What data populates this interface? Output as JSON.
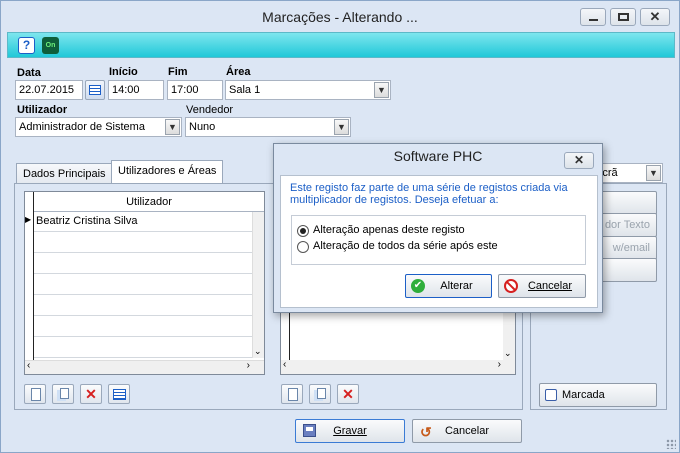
{
  "window": {
    "title": "Marcações - Alterando ..."
  },
  "toolbar": {
    "icons": [
      "help-icon",
      "on-icon"
    ]
  },
  "form": {
    "data_label": "Data",
    "data_value": "22.07.2015",
    "inicio_label": "Início",
    "inicio_value": "14:00",
    "fim_label": "Fim",
    "fim_value": "17:00",
    "area_label": "Área",
    "area_value": "Sala 1",
    "utilizador_label": "Utilizador",
    "utilizador_value": "Administrador de Sistema",
    "vendedor_label": "Vendedor",
    "vendedor_value": "Nuno"
  },
  "tabs": [
    {
      "label": "Dados Principais"
    },
    {
      "label": "Utilizadores e Áreas"
    }
  ],
  "users_grid": {
    "header": "Utilizador",
    "rows": [
      "Beatriz Cristina Silva"
    ]
  },
  "right_panel": {
    "dropdown_value": "Ecrã",
    "btn_texto": "dor Texto",
    "btn_email": "w/email",
    "marcada_label": "Marcada"
  },
  "footer": {
    "gravar": "Gravar",
    "cancelar": "Cancelar"
  },
  "dialog": {
    "title": "Software PHC",
    "message": "Este registo faz parte de uma série de registos criada via multiplicador de registos. Deseja efetuar a:",
    "option1": "Alteração apenas deste registo",
    "option2": "Alteração de todos da série após este",
    "alterar": "Alterar",
    "cancelar": "Cancelar"
  },
  "colors": {
    "accent_blue": "#1c5fc7",
    "toolbar_cyan": "#20c8d8"
  }
}
